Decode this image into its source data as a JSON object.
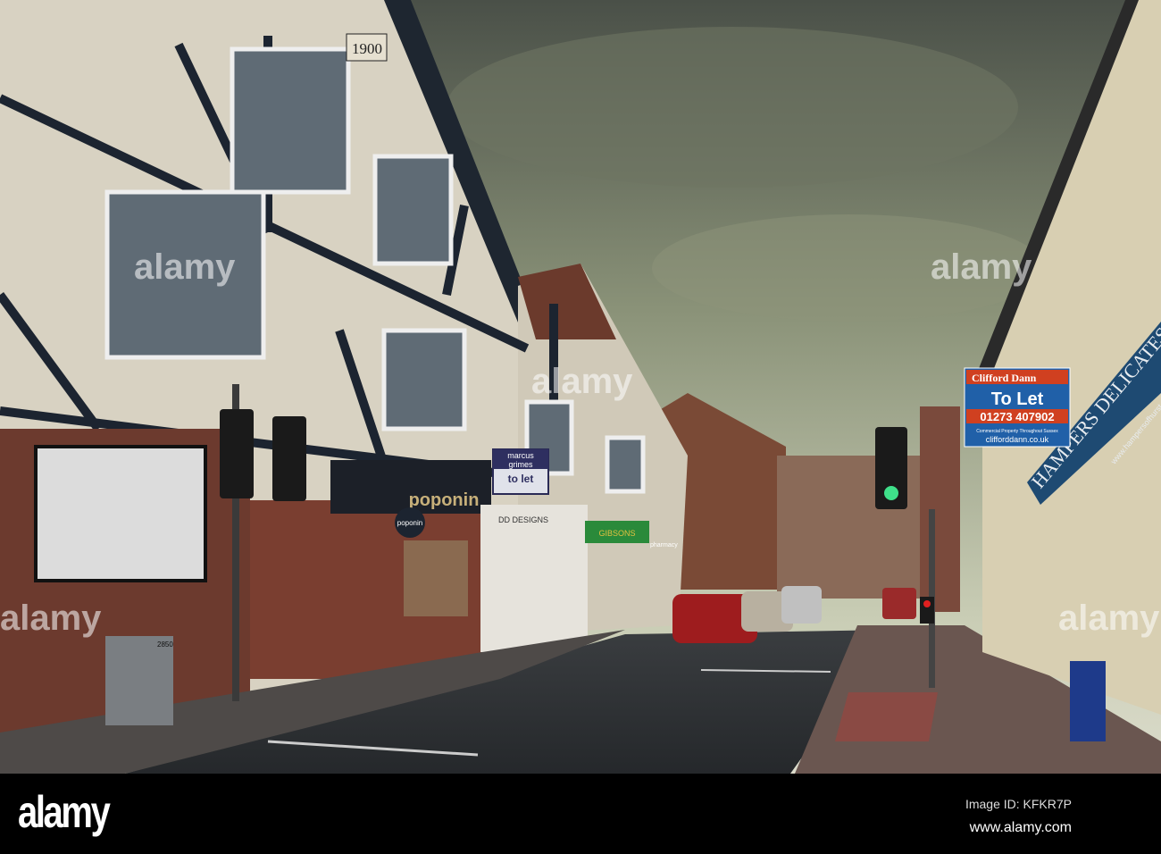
{
  "photo": {
    "year_plaque": "1900",
    "shop_sign": "poponin",
    "shop_round_sign": "poponin",
    "agent_sign": {
      "line1": "marcus",
      "line2": "grimes",
      "line3": "to let"
    },
    "designs_sign": "DD DESIGNS",
    "green_shop_sign": "GIBSONS",
    "pharmacy_sign": "pharmacy",
    "utility_box_number": "2850",
    "to_let_board": {
      "agency": "Clifford Dann",
      "headline": "To Let",
      "phone": "01273 407902",
      "tagline": "Commercial Property Throughout Sussex",
      "website": "clifforddann.co.uk"
    },
    "awning_text": "HAMPERS DELICATESSEN",
    "awning_web": "www.hampersofhurst",
    "watermark": "alamy"
  },
  "footer": {
    "logo": "alamy",
    "image_id": "Image ID: KFKR7P",
    "url": "www.alamy.com"
  }
}
